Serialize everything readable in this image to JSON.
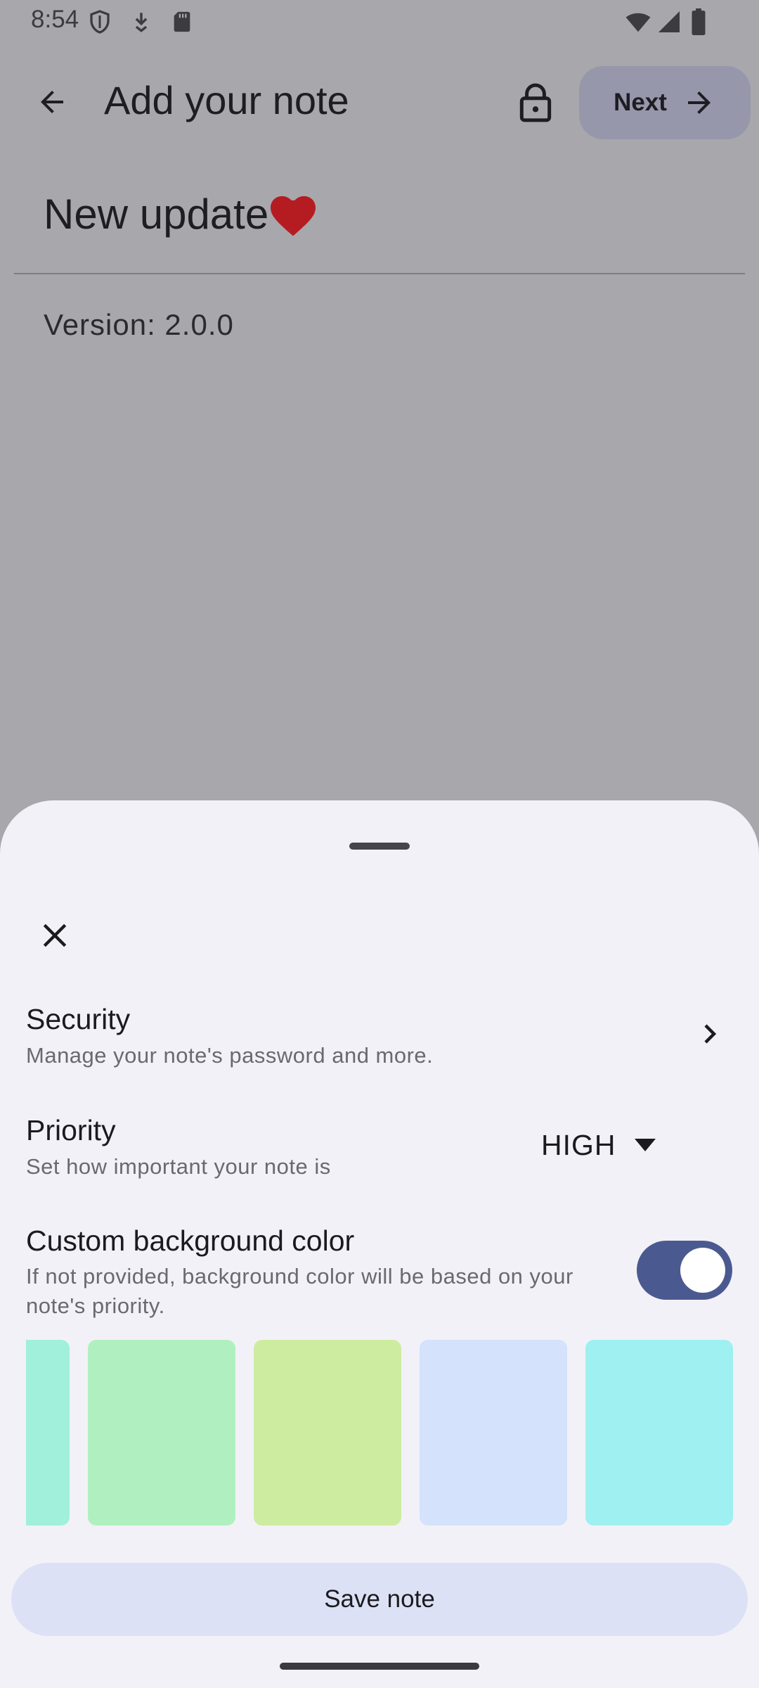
{
  "status_bar": {
    "time": "8:54",
    "left_icons": [
      "shield-icon",
      "download-icon",
      "sd-card-icon"
    ],
    "right_icons": [
      "wifi-icon",
      "signal-icon",
      "battery-icon"
    ]
  },
  "app_bar": {
    "title": "Add your note",
    "back_icon": "arrow-back-icon",
    "lock_icon": "lock-icon",
    "next_label": "Next",
    "next_icon": "arrow-forward-icon"
  },
  "note": {
    "title": "New update",
    "title_emoji": "heart-icon",
    "body": "Version: 2.0.0"
  },
  "sheet": {
    "close_icon": "close-icon",
    "security": {
      "title": "Security",
      "subtitle": "Manage your note's password and more."
    },
    "priority": {
      "title": "Priority",
      "subtitle": "Set how important your note is",
      "selected": "HIGH"
    },
    "custom_bg": {
      "title": "Custom background color",
      "subtitle": "If not provided, background color will be based on your note's priority.",
      "enabled": true
    },
    "swatches": [
      "#a0f0dc",
      "#b0f0c0",
      "#cdeca0",
      "#d4e2fc",
      "#9ff0f0"
    ],
    "save_label": "Save note"
  },
  "colors": {
    "toggle_track": "#4a5a91",
    "save_button": "#dde1f5",
    "sheet_background": "#f3f1f8"
  }
}
